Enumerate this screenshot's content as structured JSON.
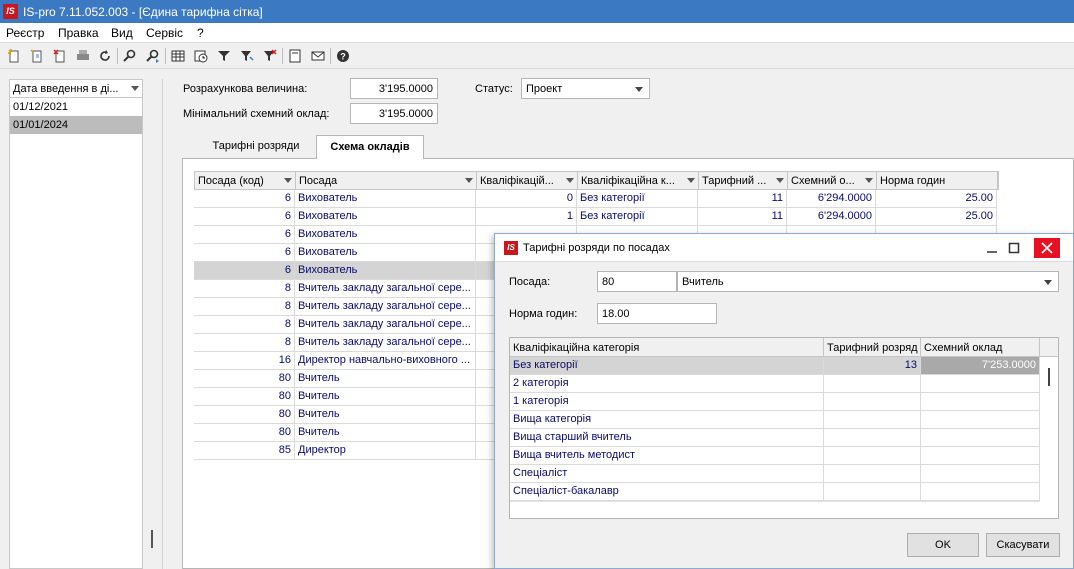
{
  "window": {
    "title": "IS-pro 7.11.052.003 - [Єдина тарифна сітка]",
    "logo": "IS"
  },
  "menu": [
    "Реєстр",
    "Правка",
    "Вид",
    "Сервіс",
    "?"
  ],
  "toolbar_icons": [
    "new-doc-icon",
    "new-copy-icon",
    "delete-doc-icon",
    "print-icon",
    "refresh-icon",
    "search-icon",
    "search-next-icon",
    "table-icon",
    "clock-icon",
    "filter-icon",
    "filter-edit-icon",
    "filter-clear-icon",
    "document-icon",
    "mail-icon",
    "help-icon"
  ],
  "left_panel": {
    "header": "Дата введення в ді...",
    "rows": [
      "01/12/2021",
      "01/01/2024"
    ],
    "selected_index": 1
  },
  "form": {
    "calc_value_label": "Розрахункова величина:",
    "calc_value": "3'195.0000",
    "min_salary_label": "Мінімальний схемний оклад:",
    "min_salary": "3'195.0000",
    "status_label": "Статус:",
    "status_value": "Проект"
  },
  "tabs": [
    "Тарифні розряди",
    "Схема окладів"
  ],
  "active_tab": 1,
  "grid": {
    "headers": [
      "Посада (код)",
      "Посада",
      "Кваліфікацій...",
      "Кваліфікаційна к...",
      "Тарифний ...",
      "Схемний о...",
      "Норма годин"
    ],
    "rows": [
      [
        "6",
        "Вихователь",
        "0",
        "Без категорії",
        "11",
        "6'294.0000",
        "25.00"
      ],
      [
        "6",
        "Вихователь",
        "1",
        "Без категорії",
        "11",
        "6'294.0000",
        "25.00"
      ],
      [
        "6",
        "Вихователь",
        "",
        "",
        "",
        "",
        ""
      ],
      [
        "6",
        "Вихователь",
        "",
        "",
        "",
        "",
        ""
      ],
      [
        "6",
        "Вихователь",
        "",
        "",
        "",
        "",
        ""
      ],
      [
        "8",
        "Вчитель закладу загальної сере...",
        "",
        "",
        "",
        "",
        ""
      ],
      [
        "8",
        "Вчитель закладу загальної сере...",
        "",
        "",
        "",
        "",
        ""
      ],
      [
        "8",
        "Вчитель закладу загальної сере...",
        "",
        "",
        "",
        "",
        ""
      ],
      [
        "8",
        "Вчитель закладу загальної сере...",
        "",
        "",
        "",
        "",
        ""
      ],
      [
        "16",
        "Директор навчально-виховного ...",
        "",
        "",
        "",
        "",
        ""
      ],
      [
        "80",
        "Вчитель",
        "",
        "",
        "",
        "",
        ""
      ],
      [
        "80",
        "Вчитель",
        "",
        "",
        "",
        "",
        ""
      ],
      [
        "80",
        "Вчитель",
        "",
        "",
        "",
        "",
        ""
      ],
      [
        "80",
        "Вчитель",
        "",
        "",
        "",
        "",
        ""
      ],
      [
        "85",
        "Директор",
        "",
        "",
        "",
        "",
        ""
      ]
    ],
    "selected_index": 4
  },
  "dialog": {
    "title": "Тарифні розряди по посадах",
    "position_label": "Посада:",
    "position_code": "80",
    "position_name": "Вчитель",
    "norm_label": "Норма годин:",
    "norm_value": "18.00",
    "grid_headers": [
      "Кваліфікаційна категорія",
      "Тарифний розряд",
      "Схемний оклад"
    ],
    "grid_rows": [
      [
        "Без категорії",
        "13",
        "7'253.0000"
      ],
      [
        "2 категорія",
        "",
        ""
      ],
      [
        "1 категорія",
        "",
        ""
      ],
      [
        "Вища категорія",
        "",
        ""
      ],
      [
        "Вища старший вчитель",
        "",
        ""
      ],
      [
        "Вища вчитель методист",
        "",
        ""
      ],
      [
        "Спеціаліст",
        "",
        ""
      ],
      [
        "Спеціаліст-бакалавр",
        "",
        ""
      ]
    ],
    "ok_label": "OK",
    "cancel_label": "Скасувати"
  }
}
